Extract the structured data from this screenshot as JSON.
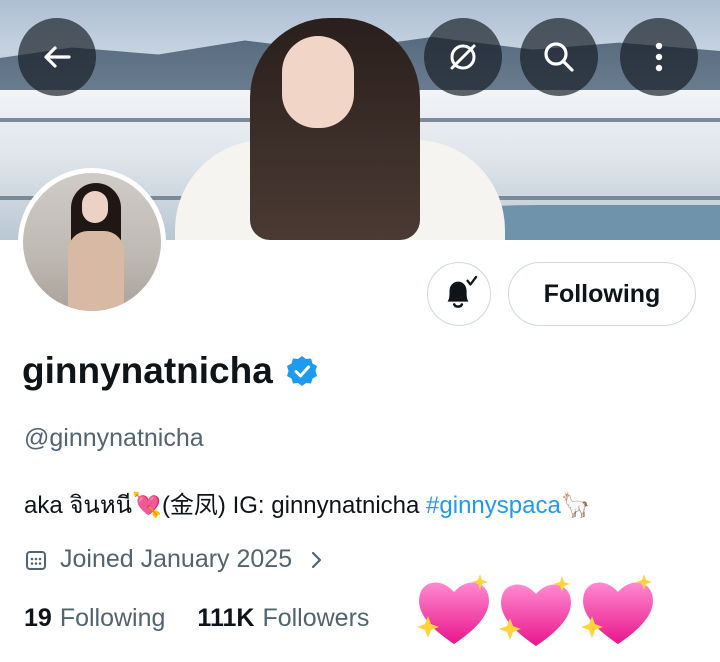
{
  "header": {
    "back_icon": "arrow-left-icon",
    "grok_icon": "grok-icon",
    "search_icon": "search-icon",
    "more_icon": "more-vertical-icon"
  },
  "profile": {
    "display_name": "ginnynatnicha",
    "verified": true,
    "verified_color": "#1d9bf0",
    "handle": "@ginnynatnicha",
    "bio_text": "aka จินหนี💘(金凤) IG: ginnynatnicha ",
    "bio_hashtag": "#ginnyspaca",
    "bio_suffix": "🦙",
    "joined": "Joined January 2025"
  },
  "actions": {
    "notifications_icon": "bell-subscribed-icon",
    "follow_label": "Following"
  },
  "stats": {
    "following_count": "19",
    "following_label": "Following",
    "followers_count": "111K",
    "followers_label": "Followers"
  },
  "decoration": {
    "hearts_icon": "sparkling-hearts-icon",
    "heart_color": "#ff4fb0"
  },
  "colors": {
    "text_primary": "#0f1419",
    "text_secondary": "#536471",
    "accent": "#1d9bf0",
    "border": "#cfd9de"
  }
}
